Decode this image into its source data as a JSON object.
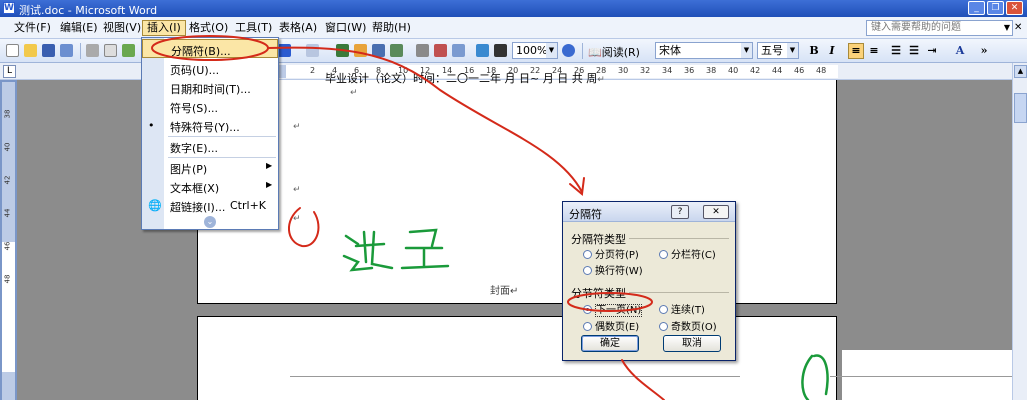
{
  "window": {
    "title": "测试.doc - Microsoft Word"
  },
  "menubar": {
    "items": [
      "文件(F)",
      "编辑(E)",
      "视图(V)",
      "插入(I)",
      "格式(O)",
      "工具(T)",
      "表格(A)",
      "窗口(W)",
      "帮助(H)"
    ],
    "help_placeholder": "键入需要帮助的问题"
  },
  "toolbar": {
    "zoom": "100%",
    "read_label": "阅读(R)",
    "font": "宋体",
    "size": "五号",
    "bold": "B",
    "italic": "I"
  },
  "ruler": {
    "ticks": [
      "2",
      "4",
      "6",
      "8",
      "10",
      "12",
      "14",
      "16",
      "18",
      "20",
      "22",
      "24",
      "26",
      "28",
      "30",
      "32",
      "34",
      "36",
      "38",
      "40",
      "42",
      "44",
      "46",
      "48"
    ]
  },
  "vruler": {
    "ticks": [
      "38",
      "40",
      "42",
      "44",
      "46",
      "48"
    ]
  },
  "insert_menu": {
    "items": [
      {
        "label": "分隔符(B)...",
        "shortcut": "",
        "submenu": false
      },
      {
        "label": "页码(U)...",
        "shortcut": "",
        "submenu": false
      },
      {
        "label": "日期和时间(T)...",
        "shortcut": "",
        "submenu": false
      },
      {
        "label": "符号(S)...",
        "shortcut": "",
        "submenu": false
      },
      {
        "label": "特殊符号(Y)...",
        "shortcut": "",
        "submenu": false
      },
      {
        "label": "数字(E)...",
        "shortcut": "",
        "submenu": false
      },
      {
        "label": "图片(P)",
        "shortcut": "",
        "submenu": true
      },
      {
        "label": "文本框(X)",
        "shortcut": "",
        "submenu": true
      },
      {
        "label": "超链接(I)...",
        "shortcut": "Ctrl+K",
        "submenu": false
      }
    ]
  },
  "document": {
    "heading": "毕业设计（论文）时间：二〇一二年  月  日~  月  日 共    周",
    "cover_header": "封面",
    "para_mark": "↵"
  },
  "dialog": {
    "title": "分隔符",
    "group1": "分隔符类型",
    "opt_page": "分页符(P)",
    "opt_column": "分栏符(C)",
    "opt_wrap": "换行符(W)",
    "group2": "分节符类型",
    "opt_next": "下一页(N)",
    "opt_continuous": "连续(T)",
    "opt_even": "偶数页(E)",
    "opt_odd": "奇数页(O)",
    "ok": "确定",
    "cancel": "取消"
  },
  "annotation": {
    "handwritten": "这里",
    "color_red": "#d42a1a",
    "color_green": "#1a9a3a"
  }
}
